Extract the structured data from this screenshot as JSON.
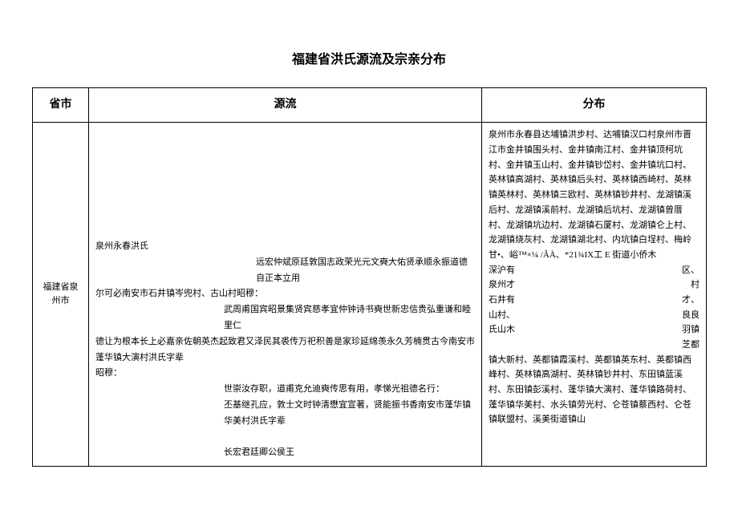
{
  "title": "福建省洪氏源流及宗亲分布",
  "headers": {
    "province": "省市",
    "origin": "源流",
    "distribution": "分布"
  },
  "row": {
    "province": "福建省泉州市",
    "origin": {
      "line1": "泉州永春洪氏",
      "line2": "远宏仲斌原廷敦国志政荣光元文奭大佑贤承顺永振道德自正本立用",
      "line3": "尔可必南安市石井镇岑兜村、古山村昭穆：",
      "line4": "武周甫国宾昭景集贤宾慈孝宜仲钟诗书奭世新忠信贵弘重谦和睦里仁",
      "line5": "德让为根本长上必嘉亲佐朝英杰起致君又泽民其裘传万祀积善是家珍延绵羡永久芳楠贯古今南安市蓬华镇大演村洪氏字辈",
      "line6": "昭穆：",
      "line7": "世崇汝存职，道甫克允迪奭传思有用，孝悌光祖德名行：",
      "line8": "丕基继孔应，敦士文时钟清懋宜宣著，贤能振书香南安市蓬华镇华美村洪氏字辈",
      "line9": "长宏君廷卿公侯王"
    },
    "distribution": {
      "para1": "泉州市永春县达埔镇洪步村、达哺镇汉口村泉州市晋江市金井镇围头村、金井镇南江村、金井镇顶柯坑村、金井镇玉山村、金井镇钞岱村、金井镇坑口村、英林镇高湖村、英林镇后头村、英林镇西崎村、英林镇英林村、英林镇三欧村、英林镇钞井村、龙湖镇溪后村、龙湖镇溪前村、龙湖镇后坑村、龙湖镇曾厝村、龙湖镇坑边村、龙湖镇石厦村、龙湖镇仑上村、龙湖镇烧灰村、龙湖镇湖北村、内坑镇白埕村、梅岭甘•、峪™×¼ /ÂÀ、*21¾IX工 E 街道小侨木",
      "row1left": "深沪有",
      "row1right": "区、",
      "row2left": "泉州才",
      "row2right": "村",
      "row3left": "石井有",
      "row3right": "才、",
      "row4left": "山村、",
      "row4right": "良良",
      "row5left": "氏山木",
      "row5right": "羽镇",
      "row6": "芝都",
      "para2": "镇大新村、英都镇霞溪村、英都镇英东村、英都镇西峰村、英林镇高湖村、英林镇钞井村、东田镇蓝溪村、东田镇彭溪村、蓬华镇大演村、蓬华镇路荷村、蓬华镇华美村、水头镇劳光村、仑苍镇蔡西村、仑苍镇联盟村、溪美街道镇山"
    }
  }
}
